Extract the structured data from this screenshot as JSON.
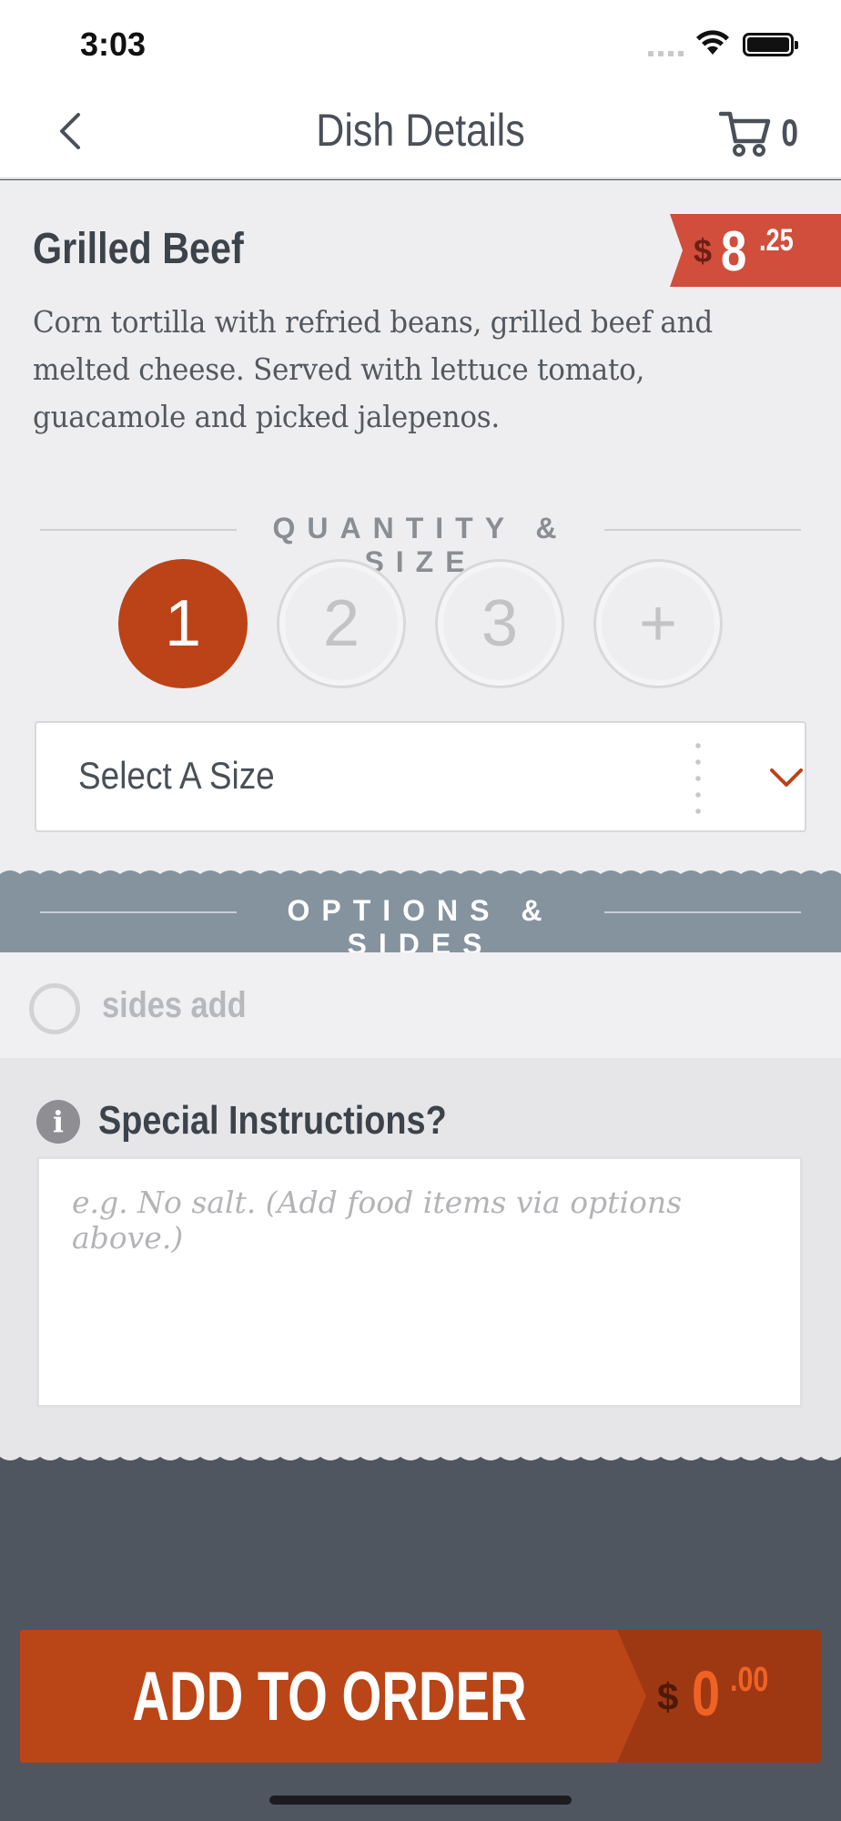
{
  "status_bar": {
    "time": "3:03"
  },
  "nav": {
    "title": "Dish Details",
    "cart_count": "0"
  },
  "dish": {
    "name": "Grilled Beef",
    "price_currency": "$",
    "price_main": "8",
    "price_cents": ".25",
    "description": "Corn tortilla with refried beans, grilled beef and melted cheese. Served with lettuce tomato, guacamole and picked jalepenos."
  },
  "quantity": {
    "heading": "QUANTITY & SIZE",
    "options": [
      "1",
      "2",
      "3",
      "+"
    ],
    "selected": "1"
  },
  "size_select": {
    "value": "Select A Size"
  },
  "options": {
    "heading": "OPTIONS & SIDES",
    "items": [
      {
        "label": "sides add",
        "checked": false
      }
    ]
  },
  "instructions": {
    "title": "Special Instructions?",
    "placeholder": "e.g. No salt. (Add food items via options above.)"
  },
  "order": {
    "label": "ADD TO ORDER",
    "total_currency": "$",
    "total_main": "0",
    "total_cents": ".00"
  },
  "colors": {
    "accent": "#bb4317",
    "price_tag": "#d04e3b",
    "options_band": "#85939f",
    "footer": "#4f5660"
  }
}
